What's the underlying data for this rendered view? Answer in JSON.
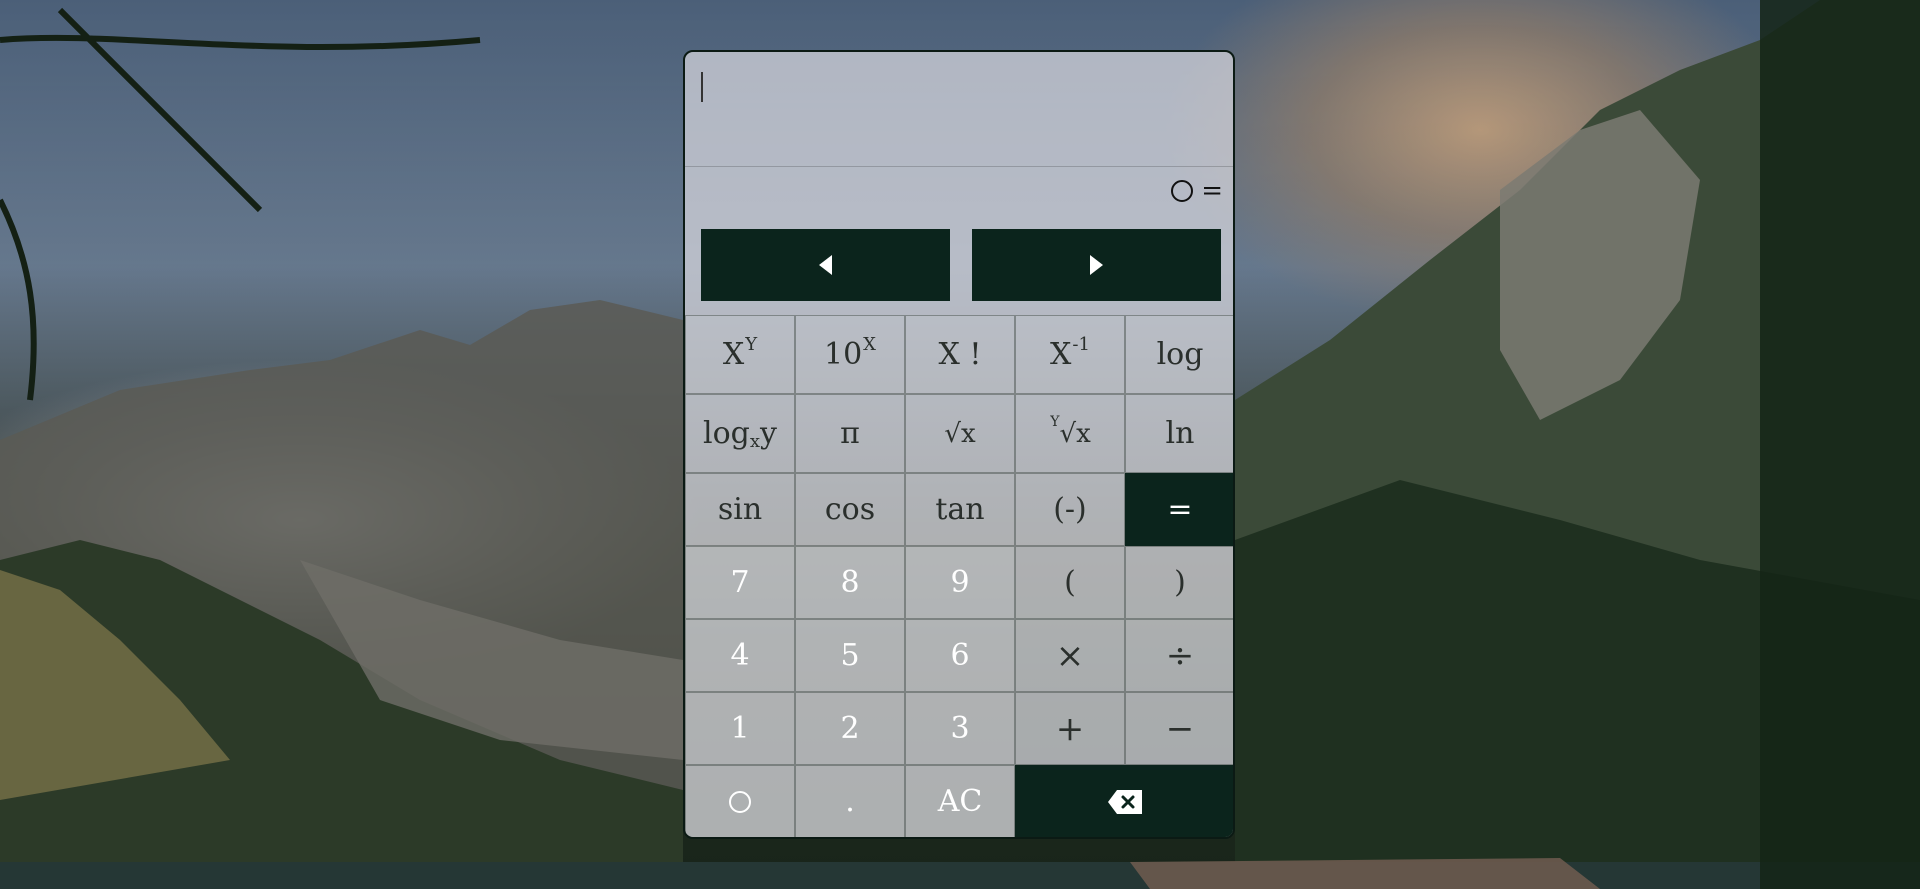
{
  "display": {
    "expression": "",
    "result": "0"
  },
  "nav": {
    "left_icon": "triangle-left-icon",
    "right_icon": "triangle-right-icon"
  },
  "keys": {
    "row1": [
      "X",
      "Y",
      "10",
      "X",
      "X",
      "!",
      "X",
      "-1",
      "log"
    ],
    "row2": {
      "logxy_a": "log",
      "logxy_b": "x",
      "logxy_c": "y",
      "pi": "π",
      "sqrt": "√x",
      "rootx_idx": "Y",
      "rootx": "√x",
      "ln": "ln"
    },
    "row3": [
      "sin",
      "cos",
      "tan",
      "(-)",
      "="
    ],
    "row4": [
      "7",
      "8",
      "9",
      "(",
      ")"
    ],
    "row5": [
      "4",
      "5",
      "6",
      "×",
      "÷"
    ],
    "row6": [
      "1",
      "2",
      "3",
      "+",
      "−"
    ],
    "row7": {
      "dot": ".",
      "clear": "AC",
      "backspace_icon": "backspace-icon"
    }
  },
  "result_equals": "="
}
